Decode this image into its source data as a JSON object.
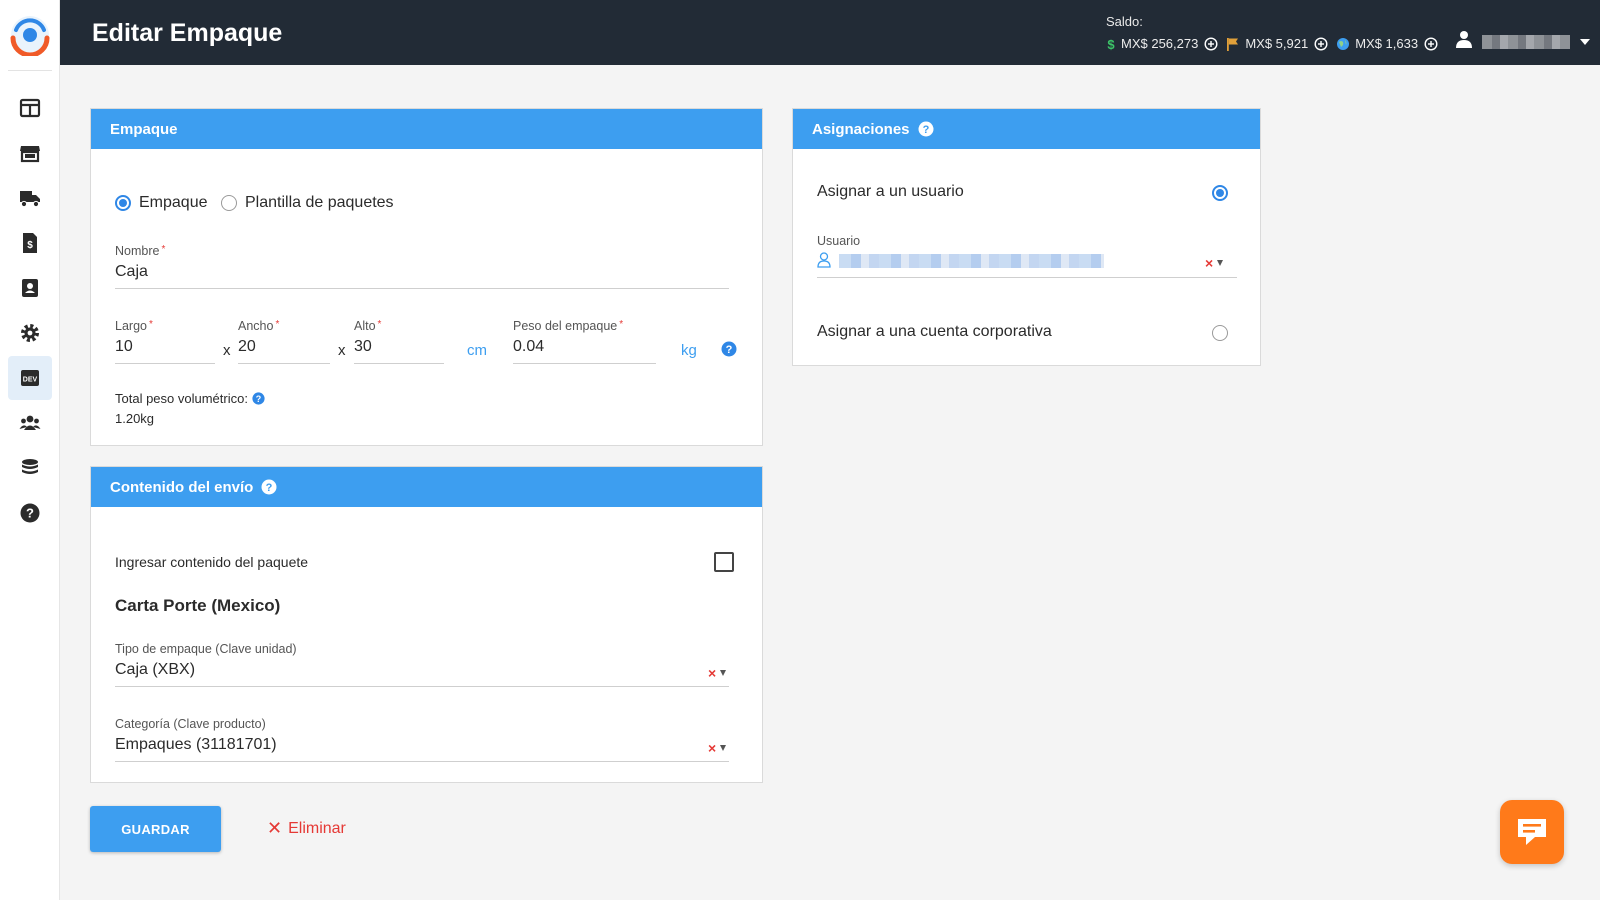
{
  "header": {
    "title": "Editar Empaque",
    "balance_label": "Saldo:",
    "balances": [
      {
        "icon": "dollar-icon",
        "value": "MX$ 256,273",
        "color": "#3cc468"
      },
      {
        "icon": "flag-icon",
        "value": "MX$ 5,921",
        "color": "#e0a03a"
      },
      {
        "icon": "globe-icon",
        "value": "MX$ 1,633",
        "color": "#3d9ef0"
      }
    ]
  },
  "sidebar": {
    "items": [
      {
        "name": "dashboard",
        "icon": "layout-icon"
      },
      {
        "name": "store",
        "icon": "store-icon"
      },
      {
        "name": "shipments",
        "icon": "truck-icon"
      },
      {
        "name": "invoices",
        "icon": "invoice-icon"
      },
      {
        "name": "contacts",
        "icon": "address-book-icon"
      },
      {
        "name": "settings",
        "icon": "gear-icon"
      },
      {
        "name": "developers",
        "icon": "dev-icon",
        "label": "DEV",
        "active": true
      },
      {
        "name": "users",
        "icon": "users-icon"
      },
      {
        "name": "billing",
        "icon": "coins-icon"
      },
      {
        "name": "help",
        "icon": "help-icon"
      }
    ]
  },
  "empaque_card": {
    "title": "Empaque",
    "radio_empaque": "Empaque",
    "radio_plantilla": "Plantilla de paquetes",
    "selected": "Empaque",
    "nombre_label": "Nombre",
    "nombre_value": "Caja",
    "largo_label": "Largo",
    "largo_value": "10",
    "ancho_label": "Ancho",
    "ancho_value": "20",
    "alto_label": "Alto",
    "alto_value": "30",
    "times": "x",
    "dim_unit": "cm",
    "peso_label": "Peso del empaque",
    "peso_value": "0.04",
    "peso_unit": "kg",
    "vol_label": "Total peso volumétrico:",
    "vol_value": "1.20kg"
  },
  "contenido_card": {
    "title": "Contenido del envío",
    "checkbox_label": "Ingresar contenido del paquete",
    "checkbox_checked": false,
    "section_title": "Carta Porte (Mexico)",
    "tipo_label": "Tipo de empaque (Clave unidad)",
    "tipo_value": "Caja (XBX)",
    "categoria_label": "Categoría (Clave producto)",
    "categoria_value": "Empaques (31181701)"
  },
  "asignaciones_card": {
    "title": "Asignaciones",
    "option_usuario": "Asignar a un usuario",
    "usuario_label": "Usuario",
    "option_corporativa": "Asignar a una cuenta corporativa",
    "selected": "usuario"
  },
  "actions": {
    "save_label": "GUARDAR",
    "delete_label": "Eliminar"
  },
  "colors": {
    "accent": "#3d9ef0",
    "header_bg": "#222b36",
    "danger": "#e53935",
    "chat": "#ff7a1a"
  }
}
